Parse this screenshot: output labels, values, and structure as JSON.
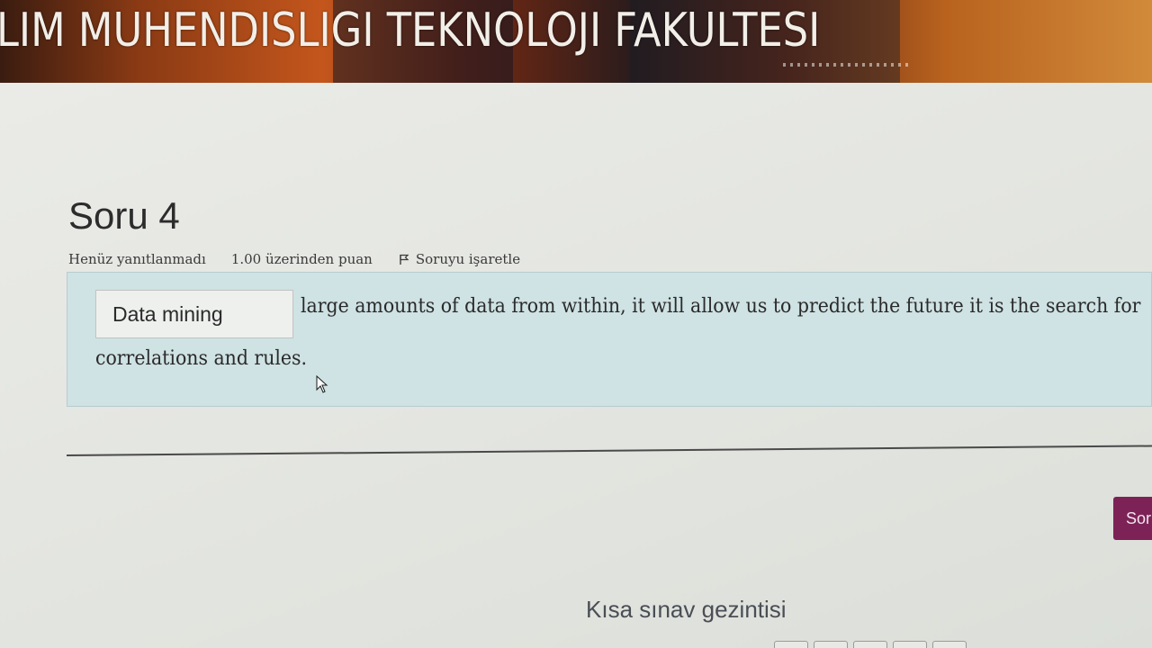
{
  "banner": {
    "title": "LIM MUHENDISLIGI TEKNOLOJI FAKULTESI"
  },
  "question": {
    "title": "Soru 4",
    "status": "Henüz yanıtlanmadı",
    "points": "1.00 üzerinden puan",
    "flag_label": "Soruyu işaretle",
    "answer_value": "Data mining",
    "text_line1": "large amounts of data from within, it will allow us to predict the future it is the search for",
    "text_line2": "correlations and rules."
  },
  "navigation": {
    "next_label": "Sor",
    "quiz_nav_title": "Kısa sınav gezintisi"
  },
  "icons": {
    "flag": "flag-icon",
    "cursor": "mouse-cursor-icon"
  },
  "colors": {
    "question_bg": "#cfe2e4",
    "button_bg": "#7d2257"
  }
}
